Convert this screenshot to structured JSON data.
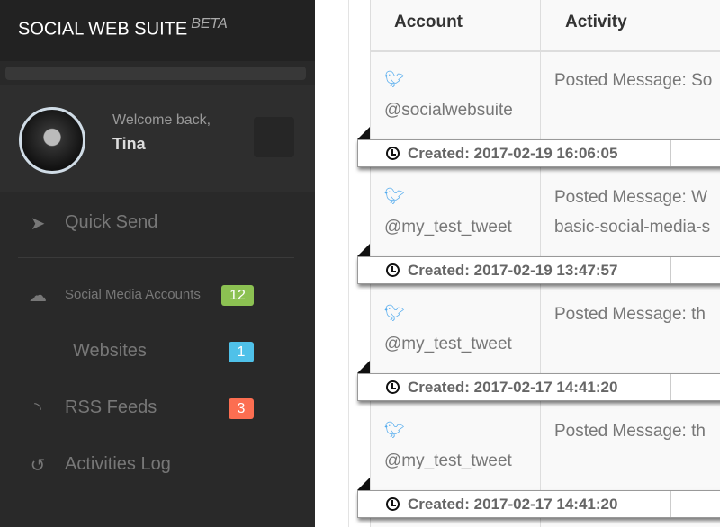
{
  "sidebar": {
    "brand": "SOCIAL WEB SUITE",
    "beta": "BETA",
    "welcome": "Welcome back,",
    "user_name": "Tina",
    "nav": [
      {
        "label": "Quick Send",
        "icon": "paper-plane-icon"
      },
      {
        "label": "Social Media Accounts",
        "icon": "cloud-icon",
        "badge": "12",
        "badge_color": "#8cc152"
      },
      {
        "label": "Websites",
        "badge": "1",
        "badge_color": "#4fc1e9"
      },
      {
        "label": "RSS Feeds",
        "icon": "rss-icon",
        "badge": "3",
        "badge_color": "#fc6e51"
      },
      {
        "label": "Activities Log",
        "icon": "history-icon"
      }
    ]
  },
  "table": {
    "headers": [
      "Account",
      "Activity"
    ],
    "rows": [
      {
        "account": "@socialwebsuite",
        "activity": [
          "Posted Message: So"
        ],
        "created": "Created: 2017-02-19 16:06:05"
      },
      {
        "account": "@my_test_tweet",
        "activity": [
          "Posted Message: W",
          "basic-social-media-s"
        ],
        "created": "Created: 2017-02-19 13:47:57"
      },
      {
        "account": "@my_test_tweet",
        "activity": [
          "Posted Message: th"
        ],
        "created": "Created: 2017-02-17 14:41:20"
      },
      {
        "account": "@my_test_tweet",
        "activity": [
          "Posted Message: th"
        ],
        "created": "Created: 2017-02-17 14:41:20"
      }
    ]
  }
}
